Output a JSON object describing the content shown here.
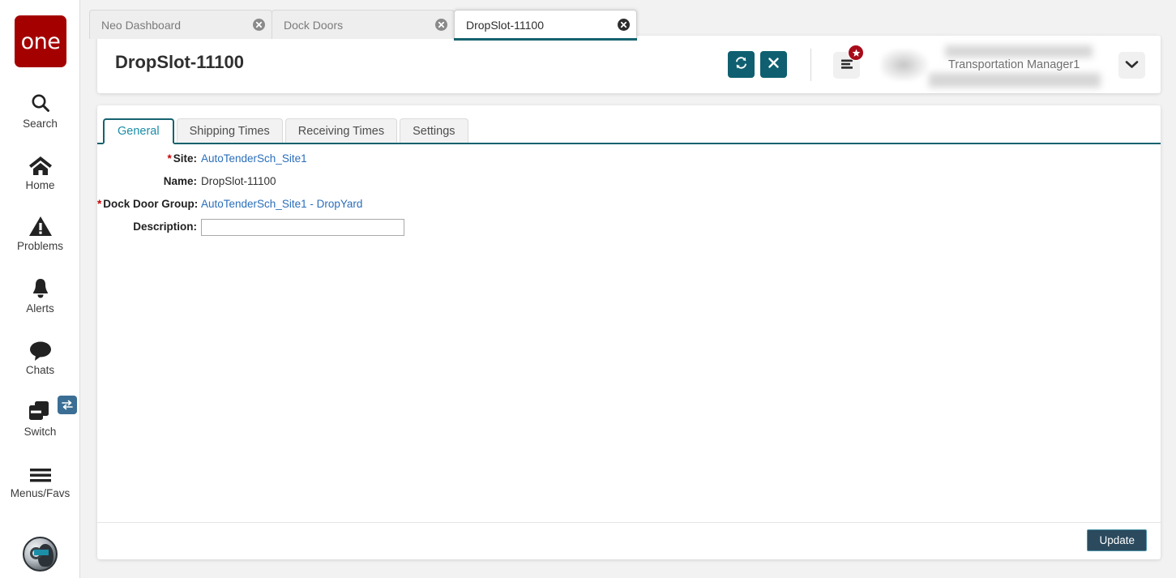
{
  "brand": {
    "logo_text": "one",
    "logo_color": "#a40000"
  },
  "theme": {
    "accent_teal": "#0f5f70",
    "tab_active_text": "#1b8ca6",
    "link_blue": "#2a6ebb",
    "required_red": "#cc0000",
    "update_button_bg": "#2b4a5e"
  },
  "rail": {
    "items": [
      {
        "label": "Search",
        "icon": "search-icon"
      },
      {
        "label": "Home",
        "icon": "home-icon"
      },
      {
        "label": "Problems",
        "icon": "warning-triangle-icon"
      },
      {
        "label": "Alerts",
        "icon": "bell-icon"
      },
      {
        "label": "Chats",
        "icon": "chat-bubble-icon"
      },
      {
        "label": "Switch",
        "icon": "switch-cards-icon"
      },
      {
        "label": "Menus/Favs",
        "icon": "hamburger-icon"
      }
    ],
    "assistant_icon": "assistant-avatar-icon"
  },
  "browser_tabs": [
    {
      "label": "Neo Dashboard",
      "active": false
    },
    {
      "label": "Dock Doors",
      "active": false
    },
    {
      "label": "DropSlot-11100",
      "active": true
    }
  ],
  "header": {
    "title": "DropSlot-11100",
    "refresh_icon": "refresh-icon",
    "close_icon": "close-x-icon",
    "menu_icon": "menu-lines-icon",
    "menu_badge_icon": "star-badge-icon",
    "avatar_icon": "user-avatar",
    "user_role": "Transportation Manager1",
    "chevron_icon": "chevron-down-icon"
  },
  "content_tabs": [
    {
      "label": "General",
      "active": true
    },
    {
      "label": "Shipping Times",
      "active": false
    },
    {
      "label": "Receiving Times",
      "active": false
    },
    {
      "label": "Settings",
      "active": false
    }
  ],
  "form": {
    "site": {
      "label": "Site:",
      "required": true,
      "value": "AutoTenderSch_Site1",
      "is_link": true
    },
    "name": {
      "label": "Name:",
      "required": false,
      "value": "DropSlot-11100",
      "is_link": false
    },
    "dock_door_group": {
      "label": "Dock Door Group:",
      "required": true,
      "value": "AutoTenderSch_Site1 - DropYard",
      "is_link": true
    },
    "description": {
      "label": "Description:",
      "required": false,
      "value": "",
      "placeholder": ""
    }
  },
  "footer": {
    "update_label": "Update"
  }
}
